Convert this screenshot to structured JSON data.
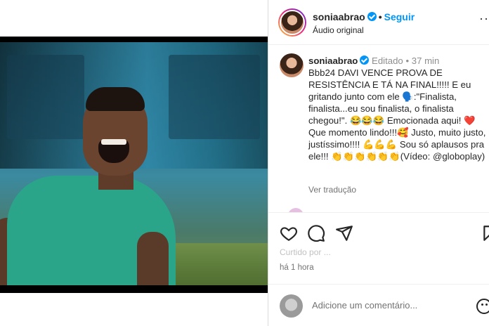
{
  "header": {
    "username": "soniaabrao",
    "dot": "•",
    "follow_label": "Seguir",
    "audio_label": "Áudio original",
    "more": "···"
  },
  "caption": {
    "username": "soniaabrao",
    "edited_label": "Editado",
    "dot": "•",
    "time_ago": "37 min",
    "text": "Bbb24 DAVI VENCE PROVA DE RESISTÊNCIA E TÁ NA FINAL!!!!! E eu gritando junto com ele 🗣️:\"Finalista, finalista...eu sou finalista, o finalista chegou!\". 😂😂😂 Emocionada aqui! ❤️ Que momento lindo!!!🥰 Justo, muito justo, justíssimo!!!! 💪💪💪 Sou só aplausos pra ele!!! 👏👏👏👏👏👏(Vídeo: @globoplay)",
    "translate_label": "Ver tradução"
  },
  "actions": {
    "liked_by": "Curtido por ...",
    "time": "há 1 hora"
  },
  "comment": {
    "placeholder": "Adicione um comentário..."
  },
  "icons": {
    "mute": "speaker-muted-icon",
    "like": "heart-icon",
    "comment": "comment-bubble-icon",
    "share": "paper-plane-icon",
    "save": "bookmark-icon",
    "emoji": "smiley-icon"
  },
  "colors": {
    "accent": "#0095f6",
    "text": "#262626",
    "muted": "#737373",
    "shirt": "#2aa58a"
  }
}
